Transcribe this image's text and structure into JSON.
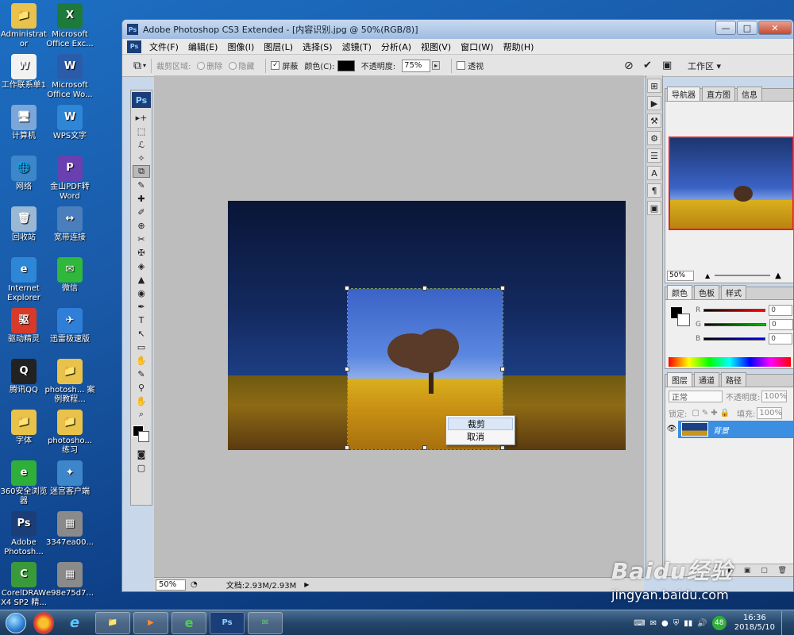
{
  "desktop": {
    "icons": [
      {
        "label": "Administrat or",
        "glyph": "📁",
        "color": "#e8c24a"
      },
      {
        "label": "Microsoft Office Exc...",
        "glyph": "X",
        "color": "#1e7a3a"
      },
      {
        "label": "工作联系单1",
        "glyph": "W",
        "color": "#f2f2f2"
      },
      {
        "label": "Microsoft Office Wo...",
        "glyph": "W",
        "color": "#2a5caa"
      },
      {
        "label": "计算机",
        "glyph": "🖥",
        "color": "#7aa7d8"
      },
      {
        "label": "WPS文字",
        "glyph": "W",
        "color": "#2d86d6"
      },
      {
        "label": "网络",
        "glyph": "🌐",
        "color": "#3c86c9"
      },
      {
        "label": "金山PDF转 Word",
        "glyph": "P",
        "color": "#6a3fb0"
      },
      {
        "label": "回收站",
        "glyph": "🗑",
        "color": "#9ab8d4"
      },
      {
        "label": "宽带连接",
        "glyph": "↔",
        "color": "#4a7ebc"
      },
      {
        "label": "Internet Explorer",
        "glyph": "e",
        "color": "#2d86d6"
      },
      {
        "label": "微信",
        "glyph": "✉",
        "color": "#2fb83b"
      },
      {
        "label": "驱动精灵",
        "glyph": "驱",
        "color": "#d83a2a"
      },
      {
        "label": "迅雷极速版",
        "glyph": "✈",
        "color": "#2f7fd8"
      },
      {
        "label": "腾讯QQ",
        "glyph": "Q",
        "color": "#222"
      },
      {
        "label": "photosh... 案例教程...",
        "glyph": "📁",
        "color": "#e8c24a"
      },
      {
        "label": "字体",
        "glyph": "📁",
        "color": "#e8c24a"
      },
      {
        "label": "photosho... 练习",
        "glyph": "📁",
        "color": "#e8c24a"
      },
      {
        "label": "360安全浏览器",
        "glyph": "e",
        "color": "#2faf3a"
      },
      {
        "label": "迷宫客户端",
        "glyph": "✦",
        "color": "#3c86c9"
      },
      {
        "label": "Adobe Photosh...",
        "glyph": "Ps",
        "color": "#1b3e78"
      },
      {
        "label": "3347ea00...",
        "glyph": "▦",
        "color": "#8a8a8a"
      },
      {
        "label": "CorelDRAW X4 SP2 精...",
        "glyph": "C",
        "color": "#3a9a3a"
      },
      {
        "label": "e98e75d7...",
        "glyph": "▦",
        "color": "#8a8a8a"
      }
    ]
  },
  "window": {
    "title": "Adobe Photoshop CS3 Extended - [内容识别.jpg @ 50%(RGB/8)]",
    "min": "—",
    "max": "□",
    "close": "✕"
  },
  "menu": {
    "items": [
      "文件(F)",
      "编辑(E)",
      "图像(I)",
      "图层(L)",
      "选择(S)",
      "滤镜(T)",
      "分析(A)",
      "视图(V)",
      "窗口(W)",
      "帮助(H)"
    ]
  },
  "options": {
    "crop_area": "裁剪区域:",
    "delete": "删除",
    "hide": "隐藏",
    "shield": "屏蔽",
    "color": "颜色(C):",
    "opacity_label": "不透明度:",
    "opacity_value": "75%",
    "perspective": "透视",
    "workspace": "工作区 ▾",
    "cancel_glyph": "⊘",
    "commit_glyph": "✔"
  },
  "tools": [
    "▸+",
    "⬚",
    "ℒ",
    "✧",
    "⧉",
    "✎",
    "✚",
    "✐",
    "⊕",
    "✂",
    "✠",
    "◈",
    "▲",
    "◉",
    "✒",
    "T",
    "↖",
    "▭",
    "✋",
    "✎",
    "⚲",
    "✋",
    "⌕"
  ],
  "context_menu": {
    "items": [
      "裁剪",
      "取消"
    ]
  },
  "status": {
    "zoom": "50%",
    "doc": "文档:2.93M/2.93M"
  },
  "right_strip": [
    "⊞",
    "▶",
    "⚒",
    "⚙",
    "☰",
    "A",
    "¶",
    "▣"
  ],
  "navigator": {
    "tabs": [
      "导航器",
      "直方图",
      "信息"
    ],
    "zoom": "50%"
  },
  "color_panel": {
    "tabs": [
      "颜色",
      "色板",
      "样式"
    ],
    "channels": [
      {
        "label": "R",
        "value": "0",
        "gradient": "#ff0000"
      },
      {
        "label": "G",
        "value": "0",
        "gradient": "#00c000"
      },
      {
        "label": "B",
        "value": "0",
        "gradient": "#0000ff"
      }
    ]
  },
  "layers_panel": {
    "tabs": [
      "图层",
      "通道",
      "路径"
    ],
    "blend": "正常",
    "opacity_label": "不透明度:",
    "opacity": "100%",
    "lock_label": "锁定:",
    "fill_label": "填充:",
    "fill": "100%",
    "layer_name": "背景"
  },
  "taskbar": {
    "apps": [
      "📁",
      "▶",
      "e",
      "Ps",
      "✉"
    ],
    "tray_badge": "48",
    "time": "16:36",
    "date": "2018/5/10"
  },
  "watermark": {
    "brand": "Baidu经验",
    "url": "jingyan.baidu.com"
  }
}
